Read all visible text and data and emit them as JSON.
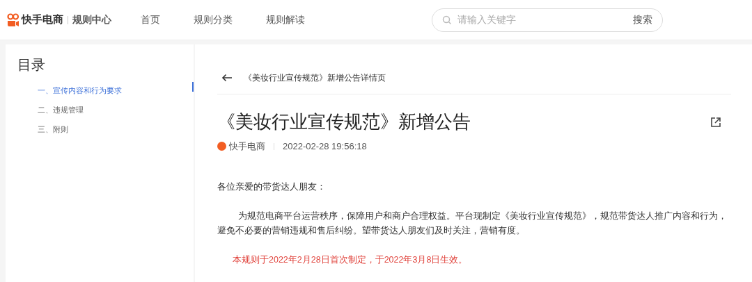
{
  "header": {
    "brand": "快手电商",
    "section": "规则中心",
    "nav": [
      {
        "label": "首页"
      },
      {
        "label": "规则分类"
      },
      {
        "label": "规则解读"
      }
    ],
    "search": {
      "placeholder": "请输入关键字",
      "button": "搜索"
    }
  },
  "toc": {
    "title": "目录",
    "items": [
      {
        "label": "一、宣传内容和行为要求",
        "selected": true
      },
      {
        "label": "二、违规管理",
        "selected": false
      },
      {
        "label": "三、附则",
        "selected": false
      }
    ]
  },
  "breadcrumb": "《美妆行业宣传规范》新增公告详情页",
  "article": {
    "title": "《美妆行业宣传规范》新增公告",
    "author": "快手电商",
    "date": "2022-02-28 19:56:18",
    "paragraphs": [
      {
        "kind": "plain",
        "text": "各位亲爱的带货达人朋友："
      },
      {
        "kind": "indented",
        "text": "为规范电商平台运营秩序，保障用户和商户合理权益。平台现制定《美妆行业宣传规范》，规范带货达人推广内容和行为，避免不必要的营销违规和售后纠纷。望带货达人朋友们及时关注，营销有度。"
      },
      {
        "kind": "notice",
        "text": "本规则于2022年2月28日首次制定，于2022年3月8日生效。"
      }
    ]
  }
}
